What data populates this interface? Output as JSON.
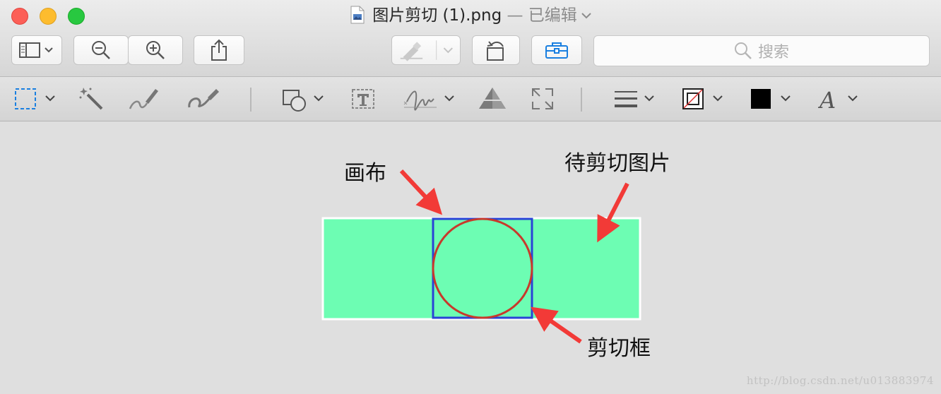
{
  "window": {
    "filename": "图片剪切 (1).png",
    "status": " — 已编辑"
  },
  "search": {
    "placeholder": "搜索"
  },
  "annotations": {
    "canvas": "画布",
    "image_to_crop": "待剪切图片",
    "crop_box": "剪切框"
  },
  "watermark": "http://blog.csdn.net/u013883974",
  "colors": {
    "image_fill": "#6dfdb3",
    "image_border": "#ffffff",
    "crop_box_border": "#2a43d6",
    "crop_circle": "#c8392b",
    "arrow": "#f23a37",
    "close": "#fc5f57",
    "minimize": "#fdbc2e",
    "maximize": "#28c840",
    "accent": "#1a7fe0"
  },
  "toolbar": {
    "icons": [
      "sidebar-icon",
      "zoom-out-icon",
      "zoom-in-icon",
      "share-icon",
      "highlight-icon",
      "rotate-icon",
      "toolbox-icon",
      "search-icon"
    ]
  },
  "markup_toolbar": {
    "icons": [
      "rectangular-selection-icon",
      "instant-alpha-icon",
      "sketch-icon",
      "draw-icon",
      "shapes-icon",
      "text-icon",
      "signature-icon",
      "adjust-color-icon",
      "adjust-size-icon",
      "line-style-icon",
      "border-color-icon",
      "fill-color-icon",
      "text-style-icon"
    ]
  }
}
